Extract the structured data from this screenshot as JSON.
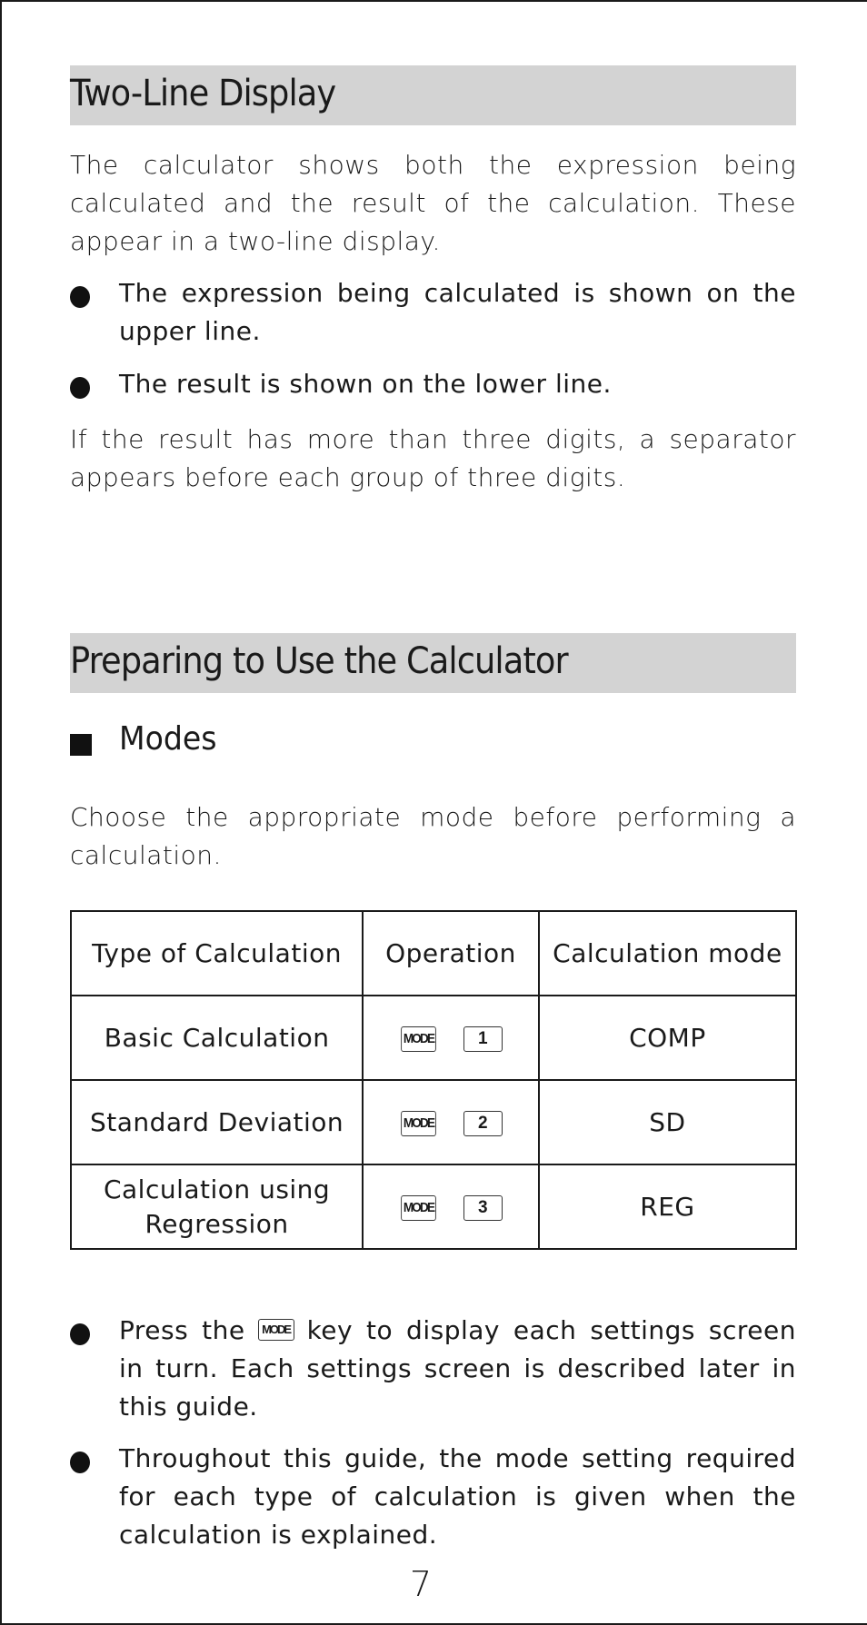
{
  "sections": [
    {
      "title": "Two-Line Display",
      "intro": "The calculator shows both the expression being calculated and the result of the calculation. These appear in a two-line display.",
      "bullets": [
        "The expression being calculated is shown on the upper line.",
        "The result is shown on the lower line."
      ],
      "outro": "If the result has more than three digits, a separator appears before each group of three digits."
    },
    {
      "title": "Preparing to Use the Calculator",
      "subsection": {
        "title": "Modes",
        "intro": "Choose the appropriate mode before performing a calculation.",
        "table": {
          "headers": [
            "Type of Calculation",
            "Operation",
            "Calculation mode"
          ],
          "rows": [
            {
              "type": "Basic Calculation",
              "keys": [
                "MODE",
                "1"
              ],
              "mode": "COMP"
            },
            {
              "type": "Standard Deviation",
              "keys": [
                "MODE",
                "2"
              ],
              "mode": "SD"
            },
            {
              "type": "Calculation using Regression",
              "keys": [
                "MODE",
                "3"
              ],
              "mode": "REG"
            }
          ]
        },
        "bullets": [
          {
            "before_key": "Press the",
            "key": "MODE",
            "after_key": "key to display each settings screen in turn. Each settings screen is described later in this guide."
          },
          {
            "text": "Throughout this guide, the mode setting required for each type of calculation is given when the calculation is explained."
          }
        ]
      }
    }
  ],
  "page_number": "7"
}
